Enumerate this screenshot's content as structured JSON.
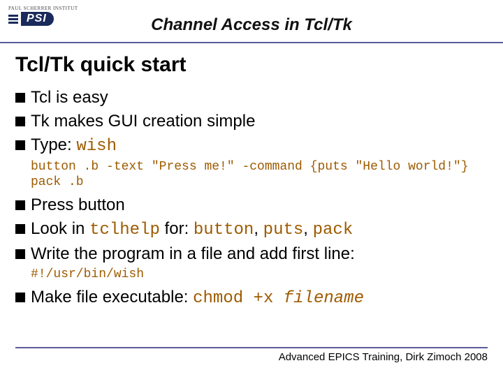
{
  "header": {
    "institute": "PAUL SCHERRER INSTITUT",
    "logo_text": "PSI",
    "title": "Channel Access in Tcl/Tk"
  },
  "section_title": "Tcl/Tk quick start",
  "bullets": {
    "b1": "Tcl is easy",
    "b2": "Tk makes GUI creation simple",
    "b3_pre": "Type: ",
    "b3_code": "wish",
    "code1_line1": "button .b -text \"Press me!\" -command {puts \"Hello world!\"}",
    "code1_line2": "pack .b",
    "b4": "Press button",
    "b5_pre": "Look in ",
    "b5_c1": "tclhelp",
    "b5_mid": " for: ",
    "b5_c2": "button",
    "b5_sep1": ", ",
    "b5_c3": "puts",
    "b5_sep2": ", ",
    "b5_c4": "pack",
    "b6": "Write the program in a file and add first line:",
    "code2": "#!/usr/bin/wish",
    "b7_pre": "Make file executable: ",
    "b7_code": "chmod +x ",
    "b7_arg": "filename"
  },
  "footer": "Advanced EPICS Training, Dirk Zimoch 2008"
}
